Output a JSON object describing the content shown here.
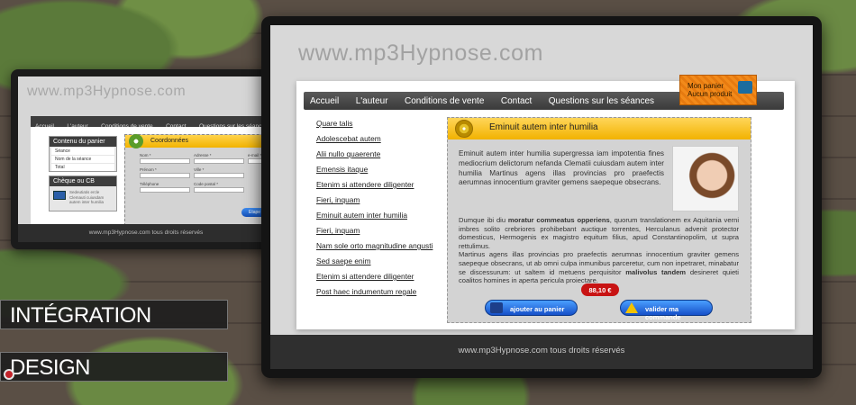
{
  "small_screen": {
    "url": "www.mp3Hypnose.com",
    "nav": [
      "Accueil",
      "L'auteur",
      "Conditions de vente",
      "Contact",
      "Questions sur les séances"
    ],
    "cart_box": {
      "title": "Contenu du panier",
      "rows": [
        "Séance",
        "Nom de la séance",
        "Total"
      ]
    },
    "payment_box": {
      "title": "Chèque ou CB",
      "text": "Sedeutiatis ercle Clemauti cuiusdam autem inter humilia"
    },
    "coord": {
      "title": "Coordonnées",
      "fields": [
        "Nom *",
        "Adresse *",
        "e-mail *",
        "Prénom *",
        "Ville *",
        "Téléphone",
        "Code postal *"
      ]
    },
    "step_button": "Etape su",
    "footer": "www.mp3Hypnose.com tous droits réservés"
  },
  "big_screen": {
    "url": "www.mp3Hypnose.com",
    "nav": [
      "Accueil",
      "L'auteur",
      "Conditions de vente",
      "Contact",
      "Questions sur les séances"
    ],
    "cart": {
      "line1": "Mon panier",
      "line2": "Aucun produit"
    },
    "links": [
      "Quare talis",
      "Adolescebat autem",
      "Alii nullo quaerente",
      "Emensis itaque",
      "Etenim si attendere diligenter",
      "Fieri, inquam",
      "Eminuit autem inter humilia",
      "Fieri, inquam",
      "Nam sole orto magnitudine angusti",
      "Sed saepe enim",
      "Etenim si attendere diligenter",
      "Post haec indumentum regale"
    ],
    "product": {
      "title": "Eminuit autem inter humilia",
      "intro": "Eminuit autem inter humilia supergressa iam impotentia fines mediocrium delictorum nefanda Clematii cuiusdam autem inter humilia Martinus agens illas provincias pro praefectis aerumnas innocentium graviter gemens saepeque obsecrans.",
      "body1_a": "Dumque ibi diu ",
      "body1_b": "moratur commeatus opperiens",
      "body1_c": ", quorum translationem ex Aquitania verni imbres solito crebriores prohibebant auctique torrentes, Herculanus advenit protector domesticus, Hermogenis ex magistro equitum filius, apud Constantinopolim, ut supra rettulimus.",
      "body2_a": "Martinus agens illas provincias pro praefectis aerumnas innocentium graviter gemens saepeque obsecrans, ut ab omni culpa inmunibus parceretur, cum non inpetraret, minabatur se discessurum: ut saltem id metuens perquisitor ",
      "body2_b": "malivolus tandem",
      "body2_c": " desineret quieti coalitos homines in aperta pericula proiectare.",
      "price": "88,10 €",
      "add_button": "ajouter au panier",
      "validate_button": "valider ma commande"
    },
    "footer": "www.mp3Hypnose.com tous droits réservés"
  },
  "labels": {
    "integration": "INTÉGRATION",
    "design": "DESIGN"
  }
}
